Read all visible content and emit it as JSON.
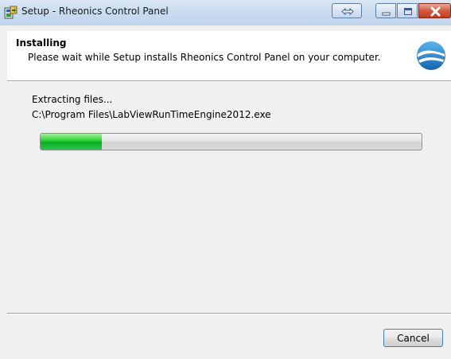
{
  "window": {
    "title": "Setup - Rheonics Control Panel"
  },
  "header": {
    "title": "Installing",
    "subtitle": "Please wait while Setup installs Rheonics Control Panel on your computer."
  },
  "status": {
    "message": "Extracting files...",
    "current_file": "C:\\Program Files\\LabViewRunTimeEngine2012.exe"
  },
  "progress": {
    "fraction": 0.16
  },
  "buttons": {
    "cancel": "Cancel"
  },
  "icons": {
    "app": "installer-icon",
    "logo": "rheonics-logo",
    "switch": "switch-windows-icon",
    "minimize": "minimize-icon",
    "maximize": "maximize-icon",
    "close": "close-icon"
  },
  "colors": {
    "progress_fill": "#06b025",
    "cancel_border": "#3c7fb1",
    "close_button": "#c23a22",
    "logo_blue": "#1f8fd6"
  }
}
